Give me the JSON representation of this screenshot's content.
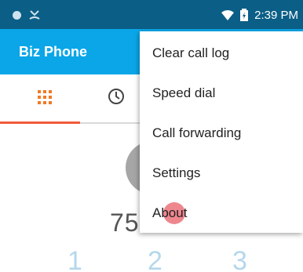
{
  "status_bar": {
    "time": "2:39 PM",
    "left_icons": [
      "circle-notification-icon",
      "missed-call-icon"
    ],
    "right_icons": [
      "wifi-icon",
      "battery-charging-icon"
    ]
  },
  "app_bar": {
    "title": "Biz Phone",
    "color": "#0aa6e8"
  },
  "tabs": [
    {
      "name": "keypad",
      "icon": "grid-icon",
      "selected": true
    },
    {
      "name": "recents",
      "icon": "clock-icon",
      "selected": false
    }
  ],
  "dialer": {
    "number_partial": "75",
    "keys": [
      "1",
      "2",
      "3"
    ]
  },
  "overflow_menu": {
    "items": [
      {
        "label": "Clear call log"
      },
      {
        "label": "Speed dial"
      },
      {
        "label": "Call forwarding"
      },
      {
        "label": "Settings"
      },
      {
        "label": "About",
        "pressed": true
      }
    ]
  },
  "colors": {
    "status_bar": "#0b5e86",
    "accent_tab": "#f05a3a",
    "grid_icon": "#f07a25",
    "ripple": "#e85e68"
  }
}
